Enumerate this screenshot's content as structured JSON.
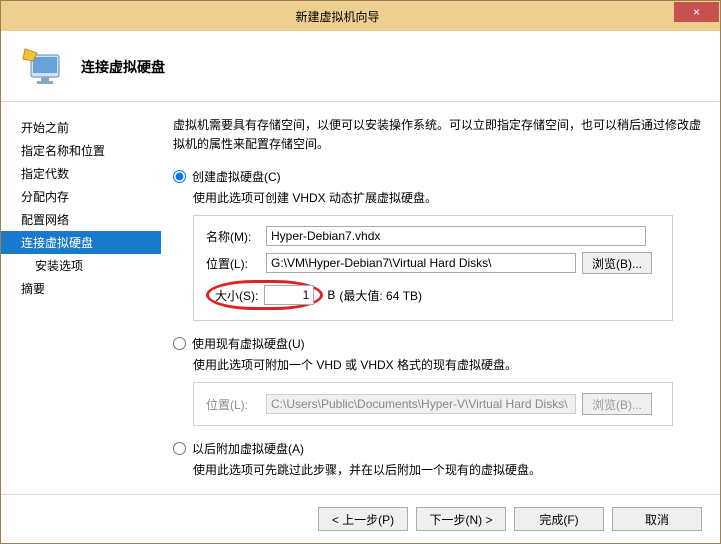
{
  "window": {
    "title": "新建虚拟机向导"
  },
  "header": {
    "title": "连接虚拟硬盘"
  },
  "sidebar": {
    "items": [
      {
        "label": "开始之前",
        "selected": false,
        "sub": false
      },
      {
        "label": "指定名称和位置",
        "selected": false,
        "sub": false
      },
      {
        "label": "指定代数",
        "selected": false,
        "sub": false
      },
      {
        "label": "分配内存",
        "selected": false,
        "sub": false
      },
      {
        "label": "配置网络",
        "selected": false,
        "sub": false
      },
      {
        "label": "连接虚拟硬盘",
        "selected": true,
        "sub": false
      },
      {
        "label": "安装选项",
        "selected": false,
        "sub": true
      },
      {
        "label": "摘要",
        "selected": false,
        "sub": false
      }
    ]
  },
  "content": {
    "description": "虚拟机需要具有存储空间，以便可以安装操作系统。可以立即指定存储空间，也可以稍后通过修改虚拟机的属性来配置存储空间。",
    "option_create": {
      "label": "创建虚拟硬盘(C)",
      "help": "使用此选项可创建 VHDX 动态扩展虚拟硬盘。",
      "name_label": "名称(M):",
      "name_value": "Hyper-Debian7.vhdx",
      "location_label": "位置(L):",
      "location_value": "G:\\VM\\Hyper-Debian7\\Virtual Hard Disks\\",
      "browse_label": "浏览(B)...",
      "size_label": "大小(S):",
      "size_value": "1",
      "size_unit_suffix": "B",
      "size_max": "(最大值: 64 TB)"
    },
    "option_existing": {
      "label": "使用现有虚拟硬盘(U)",
      "help": "使用此选项可附加一个 VHD 或 VHDX 格式的现有虚拟硬盘。",
      "location_label": "位置(L):",
      "location_value": "C:\\Users\\Public\\Documents\\Hyper-V\\Virtual Hard Disks\\",
      "browse_label": "浏览(B)..."
    },
    "option_later": {
      "label": "以后附加虚拟硬盘(A)",
      "help": "使用此选项可先跳过此步骤，并在以后附加一个现有的虚拟硬盘。"
    }
  },
  "footer": {
    "prev": "< 上一步(P)",
    "next": "下一步(N) >",
    "finish": "完成(F)",
    "cancel": "取消"
  }
}
